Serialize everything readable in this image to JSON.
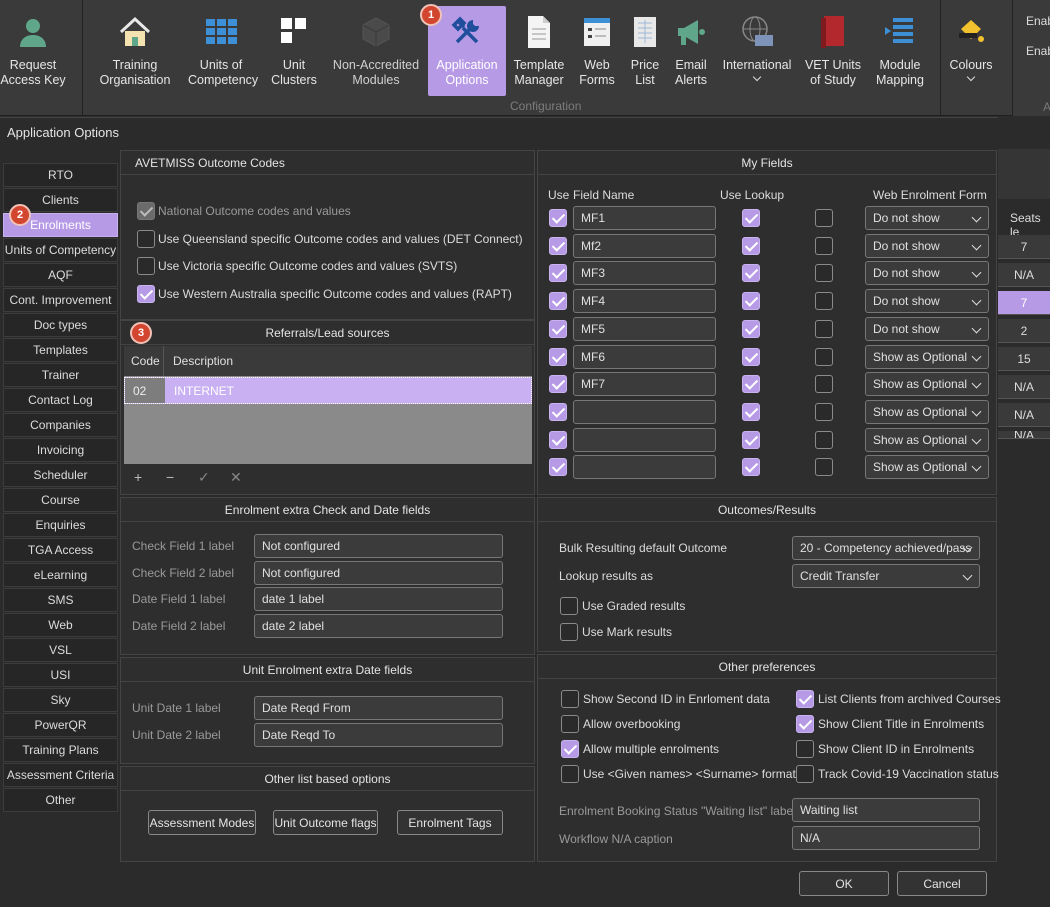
{
  "ribbon": {
    "items": [
      {
        "label": "Request\nAccess Key",
        "icon": "user-icon"
      },
      {
        "label": "Training\nOrganisation",
        "icon": "house-icon"
      },
      {
        "label": "Units of\nCompetency",
        "icon": "grid-icon"
      },
      {
        "label": "Unit\nClusters",
        "icon": "clusters-icon"
      },
      {
        "label": "Non-Accredited\nModules",
        "icon": "cube-icon"
      },
      {
        "label": "Application\nOptions",
        "icon": "tools-icon"
      },
      {
        "label": "Template\nManager",
        "icon": "document-icon"
      },
      {
        "label": "Web\nForms",
        "icon": "form-icon"
      },
      {
        "label": "Price\nList",
        "icon": "price-list-icon"
      },
      {
        "label": "Email\nAlerts",
        "icon": "megaphone-icon"
      },
      {
        "label": "International",
        "icon": "globe-icon"
      },
      {
        "label": "VET Units\nof Study",
        "icon": "book-icon"
      },
      {
        "label": "Module\nMapping",
        "icon": "mapping-icon"
      },
      {
        "label": "Colours",
        "icon": "paint-icon"
      }
    ],
    "group_label": "Configuration",
    "right_items": [
      "Enab",
      "Enab",
      "A"
    ],
    "badge1": "1"
  },
  "dialog": {
    "title": "Application Options",
    "badge2": "2",
    "badge3": "3"
  },
  "tabs": [
    "RTO",
    "Clients",
    "Enrolments",
    "Units of Competency",
    "AQF",
    "Cont. Improvement",
    "Doc types",
    "Templates",
    "Trainer",
    "Contact Log",
    "Companies",
    "Invoicing",
    "Scheduler",
    "Course",
    "Enquiries",
    "TGA Access",
    "eLearning",
    "SMS",
    "Web",
    "VSL",
    "USI",
    "Sky",
    "PowerQR",
    "Training Plans",
    "Assessment Criteria",
    "Other"
  ],
  "avetmiss": {
    "title": "AVETMISS Outcome Codes",
    "options": [
      {
        "label": "National Outcome codes and values",
        "state": "disabled"
      },
      {
        "label": "Use Queensland specific Outcome codes and values (DET Connect)",
        "state": "off"
      },
      {
        "label": "Use Victoria specific Outcome codes and values (SVTS)",
        "state": "off"
      },
      {
        "label": "Use Western Australia specific Outcome codes and values (RAPT)",
        "state": "on"
      }
    ]
  },
  "referrals": {
    "title": "Referrals/Lead sources",
    "col_code": "Code",
    "col_desc": "Description",
    "rows": [
      {
        "code": "02",
        "desc": "INTERNET"
      }
    ],
    "tools": [
      "+",
      "−",
      "✓",
      "✕"
    ]
  },
  "my_fields": {
    "title": "My Fields",
    "col_use": "Use",
    "col_name": "Field Name",
    "col_lookup": "Use Lookup",
    "col_web": "Web Enrolment Form",
    "rows": [
      {
        "name": "MF1",
        "web": "Do not show"
      },
      {
        "name": "Mf2",
        "web": "Do not show"
      },
      {
        "name": "MF3",
        "web": "Do not show"
      },
      {
        "name": "MF4",
        "web": "Do not show"
      },
      {
        "name": "MF5",
        "web": "Do not show"
      },
      {
        "name": "MF6",
        "web": "Show as Optional"
      },
      {
        "name": "MF7",
        "web": "Show as Optional"
      },
      {
        "name": "",
        "web": "Show as Optional"
      },
      {
        "name": "",
        "web": "Show as Optional"
      },
      {
        "name": "",
        "web": "Show as Optional"
      }
    ]
  },
  "enrol_extra": {
    "title": "Enrolment extra Check and Date fields",
    "rows": [
      {
        "label": "Check Field 1  label",
        "value": "Not configured"
      },
      {
        "label": "Check Field 2 label",
        "value": "Not configured"
      },
      {
        "label": "Date Field 1 label",
        "value": "date 1 label"
      },
      {
        "label": "Date Field 2 label",
        "value": "date 2 label"
      }
    ]
  },
  "unit_extra": {
    "title": "Unit Enrolment extra Date fields",
    "rows": [
      {
        "label": "Unit Date 1 label",
        "value": "Date Reqd From"
      },
      {
        "label": "Unit Date 2 label",
        "value": "Date Reqd To"
      }
    ]
  },
  "other_list": {
    "title": "Other list based options",
    "buttons": [
      "Assessment Modes",
      "Unit Outcome flags",
      "Enrolment Tags"
    ]
  },
  "outcomes": {
    "title": "Outcomes/Results",
    "bulk_label": "Bulk Resulting default Outcome",
    "bulk_value": "20 - Competency achieved/pass",
    "lookup_label": "Lookup results as",
    "lookup_value": "Credit Transfer",
    "graded": "Use Graded results",
    "mark": "Use Mark results"
  },
  "prefs": {
    "title": "Other preferences",
    "left": [
      {
        "label": "Show Second ID in Enrloment data",
        "on": false
      },
      {
        "label": "Allow overbooking",
        "on": false
      },
      {
        "label": "Allow multiple enrolments",
        "on": true
      },
      {
        "label": "Use <Given names> <Surname> format",
        "on": false
      }
    ],
    "right": [
      {
        "label": "List Clients from archived Courses",
        "on": true
      },
      {
        "label": "Show Client Title in Enrolments",
        "on": true
      },
      {
        "label": "Show Client ID in Enrolments",
        "on": false
      },
      {
        "label": "Track Covid-19 Vaccination status",
        "on": false
      }
    ],
    "waiting_label": "Enrolment Booking Status \"Waiting list\" label",
    "waiting_value": "Waiting list",
    "workflow_label": "Workflow N/A caption",
    "workflow_value": "N/A"
  },
  "footer": {
    "ok": "OK",
    "cancel": "Cancel"
  },
  "behind": {
    "header": "Seats le",
    "values": [
      "7",
      "N/A",
      "7",
      "2",
      "15",
      "N/A",
      "N/A",
      "N/A"
    ]
  }
}
